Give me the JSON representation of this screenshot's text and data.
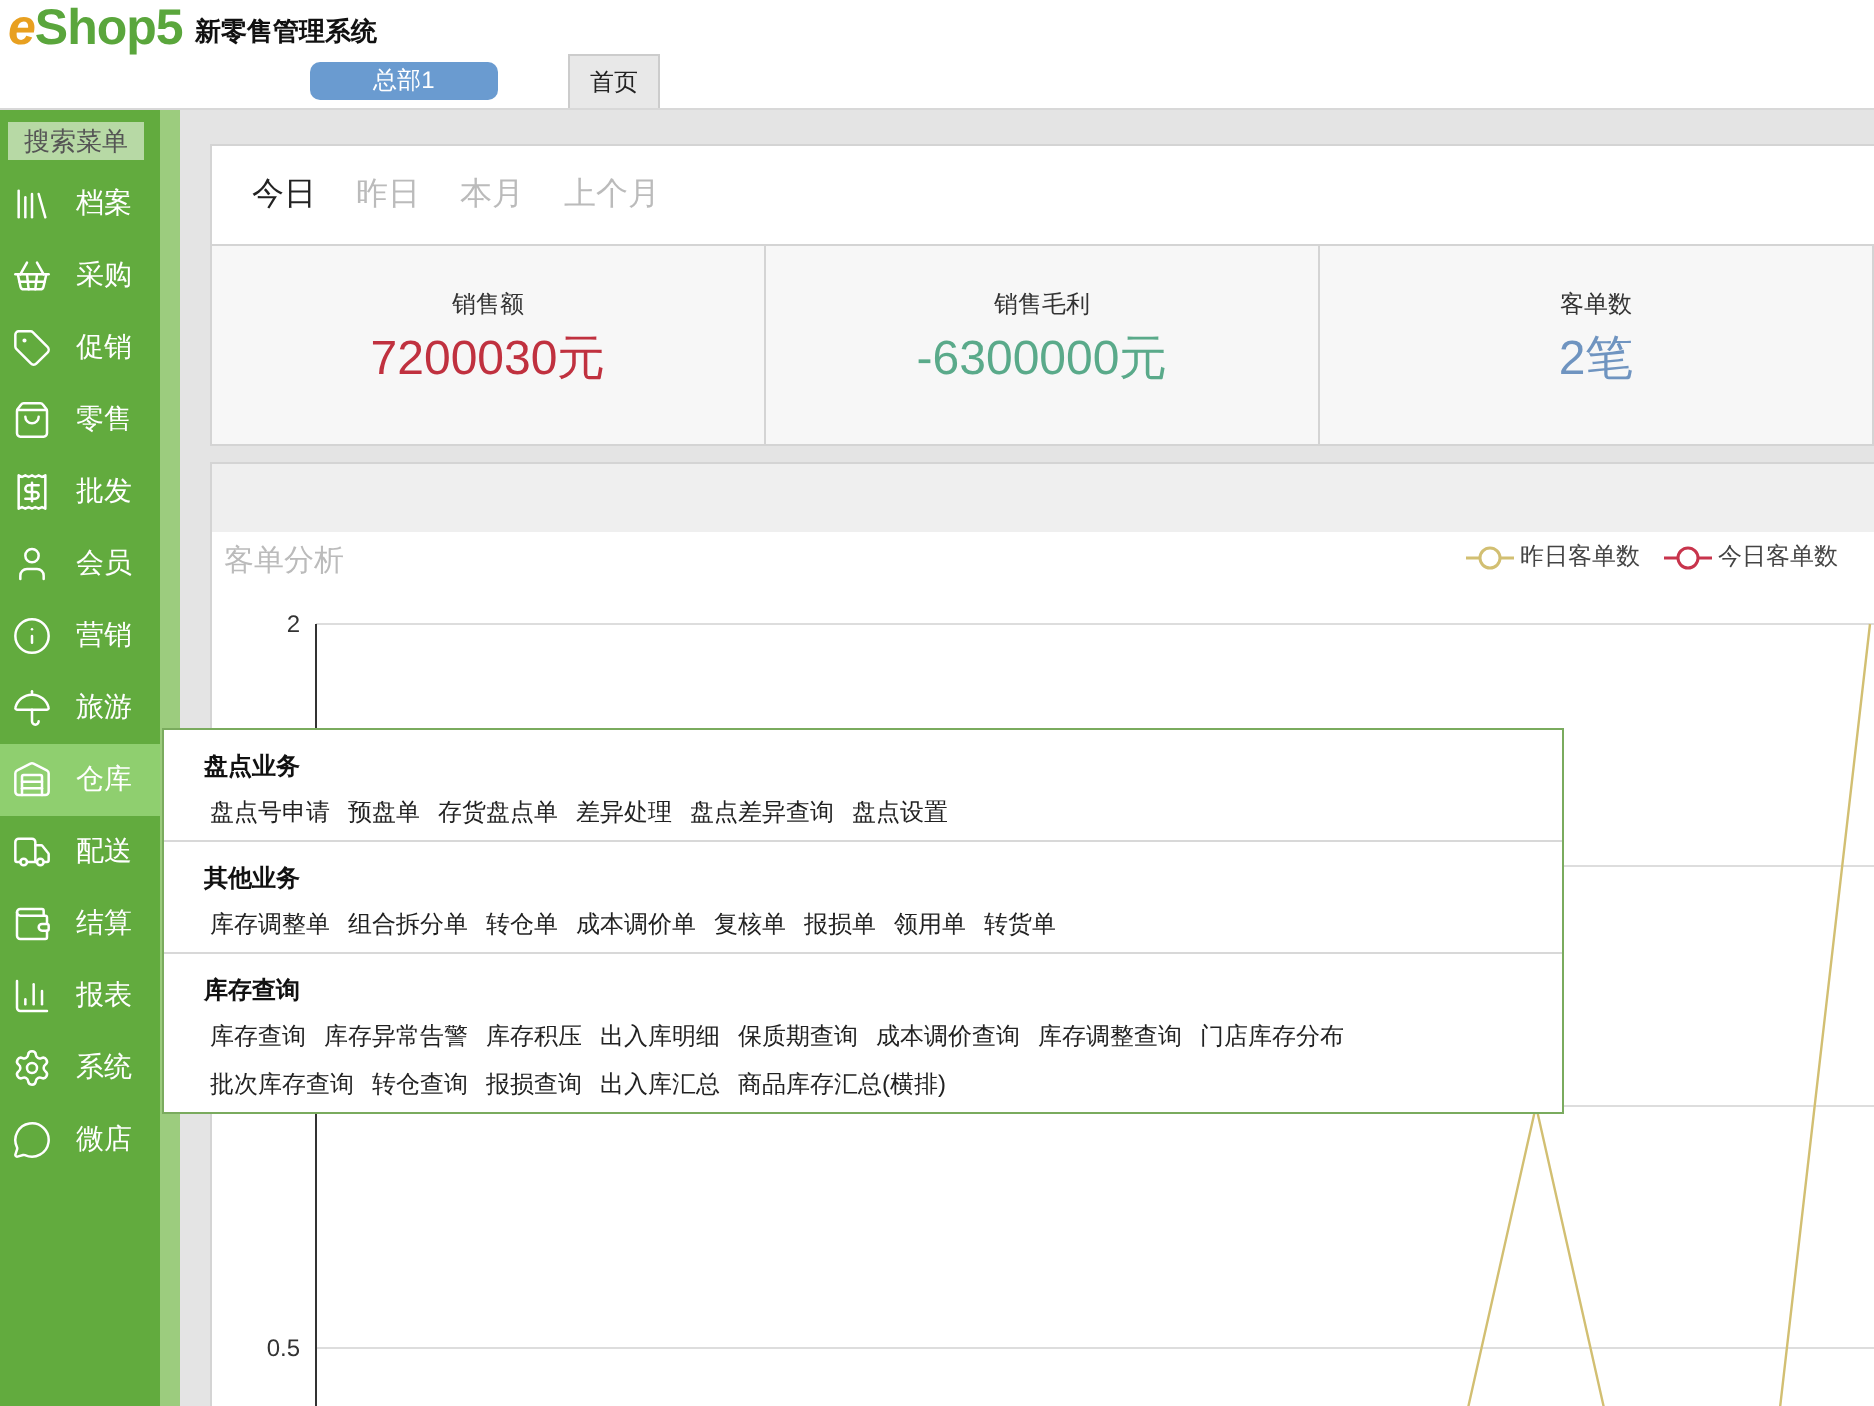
{
  "header": {
    "logo": "eShop5",
    "title": "新零售管理系统",
    "store_button": "总部1",
    "tabs": [
      {
        "label": "首页",
        "selected": true
      }
    ]
  },
  "sidebar": {
    "search": "搜索菜单",
    "items": [
      {
        "label": "档案",
        "selected": false
      },
      {
        "label": "采购",
        "selected": false
      },
      {
        "label": "促销",
        "selected": false
      },
      {
        "label": "零售",
        "selected": false
      },
      {
        "label": "批发",
        "selected": false
      },
      {
        "label": "会员",
        "selected": false
      },
      {
        "label": "营销",
        "selected": false
      },
      {
        "label": "旅游",
        "selected": false
      },
      {
        "label": "仓库",
        "selected": true
      },
      {
        "label": "配送",
        "selected": false
      },
      {
        "label": "结算",
        "selected": false
      },
      {
        "label": "报表",
        "selected": false
      },
      {
        "label": "系统",
        "selected": false
      },
      {
        "label": "微店",
        "selected": false
      }
    ]
  },
  "flyout": {
    "sections": [
      {
        "title": "盘点业务",
        "rows": [
          [
            "盘点号申请",
            "预盘单",
            "存货盘点单",
            "差异处理",
            "盘点差异查询",
            "盘点设置"
          ]
        ]
      },
      {
        "title": "其他业务",
        "rows": [
          [
            "库存调整单",
            "组合拆分单",
            "转仓单",
            "成本调价单",
            "复核单",
            "报损单",
            "领用单",
            "转货单"
          ]
        ]
      },
      {
        "title": "库存查询",
        "rows": [
          [
            "库存查询",
            "库存异常告警",
            "库存积压",
            "出入库明细",
            "保质期查询",
            "成本调价查询",
            "库存调整查询",
            "门店库存分布"
          ],
          [
            "批次库存查询",
            "转仓查询",
            "报损查询",
            "出入库汇总",
            "商品库存汇总(横排)"
          ]
        ]
      }
    ]
  },
  "periods": [
    {
      "label": "今日",
      "selected": true
    },
    {
      "label": "昨日",
      "selected": false
    },
    {
      "label": "本月",
      "selected": false
    },
    {
      "label": "上个月",
      "selected": false
    }
  ],
  "stats": [
    {
      "label": "销售额",
      "value": "7200030元",
      "color": "#c0313f"
    },
    {
      "label": "销售毛利",
      "value": "-6300000元",
      "color": "#5aaa8a"
    },
    {
      "label": "客单数",
      "value": "2笔",
      "color": "#6f94c0"
    }
  ],
  "chart": {
    "title": "客单分析",
    "y_tick_labels": [
      "2",
      "0.5"
    ],
    "legend": [
      {
        "name": "昨日客单数",
        "color": "#d2bf72"
      },
      {
        "name": "今日客单数",
        "color": "#c8344c"
      }
    ]
  }
}
